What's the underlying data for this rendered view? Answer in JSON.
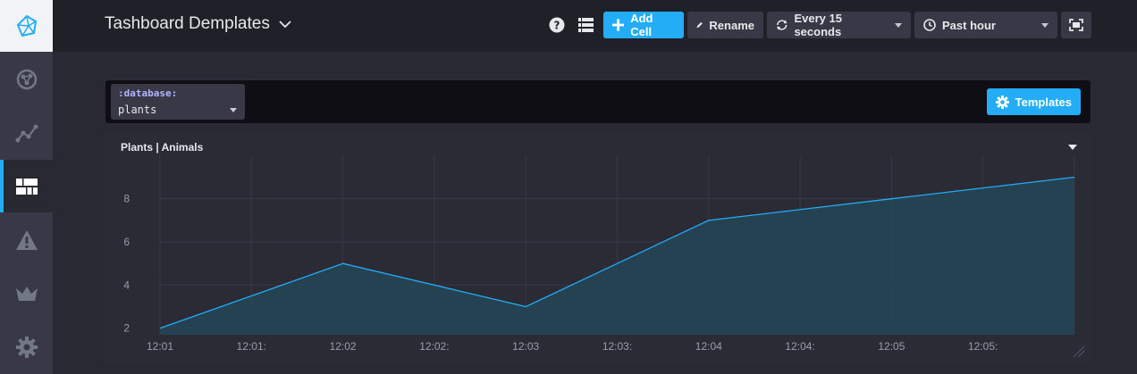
{
  "header": {
    "title": "Tashboard Demplates",
    "add_cell_label": "Add Cell",
    "rename_label": "Rename",
    "refresh_label": "Every 15 seconds",
    "time_range_label": "Past hour"
  },
  "sidebar": {
    "items": [
      {
        "name": "logo",
        "icon": "influx-logo-icon"
      },
      {
        "name": "data-explorer",
        "icon": "graph-icon"
      },
      {
        "name": "host-list",
        "icon": "line-graph-icon"
      },
      {
        "name": "dashboards",
        "icon": "dashboards-icon",
        "active": true
      },
      {
        "name": "alerts",
        "icon": "alert-triangle-icon"
      },
      {
        "name": "admin",
        "icon": "crown-icon"
      },
      {
        "name": "configuration",
        "icon": "gear-icon"
      }
    ]
  },
  "templates_bar": {
    "variable_key": ":database:",
    "variable_value": "plants",
    "templates_button": "Templates"
  },
  "cell": {
    "title": "Plants | Animals"
  },
  "colors": {
    "accent": "#22adf6",
    "line": "#22adf6",
    "fill": "#234656"
  },
  "chart_data": {
    "type": "area",
    "x": [
      "12:01",
      "12:02",
      "12:03",
      "12:04",
      "12:05",
      "12:06"
    ],
    "x_tick_labels": [
      "12:01",
      "12:01:",
      "12:02",
      "12:02:",
      "12:03",
      "12:03:",
      "12:04",
      "12:04:",
      "12:05",
      "12:05:"
    ],
    "series": [
      {
        "values": [
          2,
          5,
          3,
          7,
          8,
          9
        ]
      }
    ],
    "y_ticks": [
      2,
      4,
      6,
      8
    ],
    "ylim": [
      1.7,
      9.6
    ],
    "xlim": [
      0,
      5
    ],
    "grid": true
  }
}
